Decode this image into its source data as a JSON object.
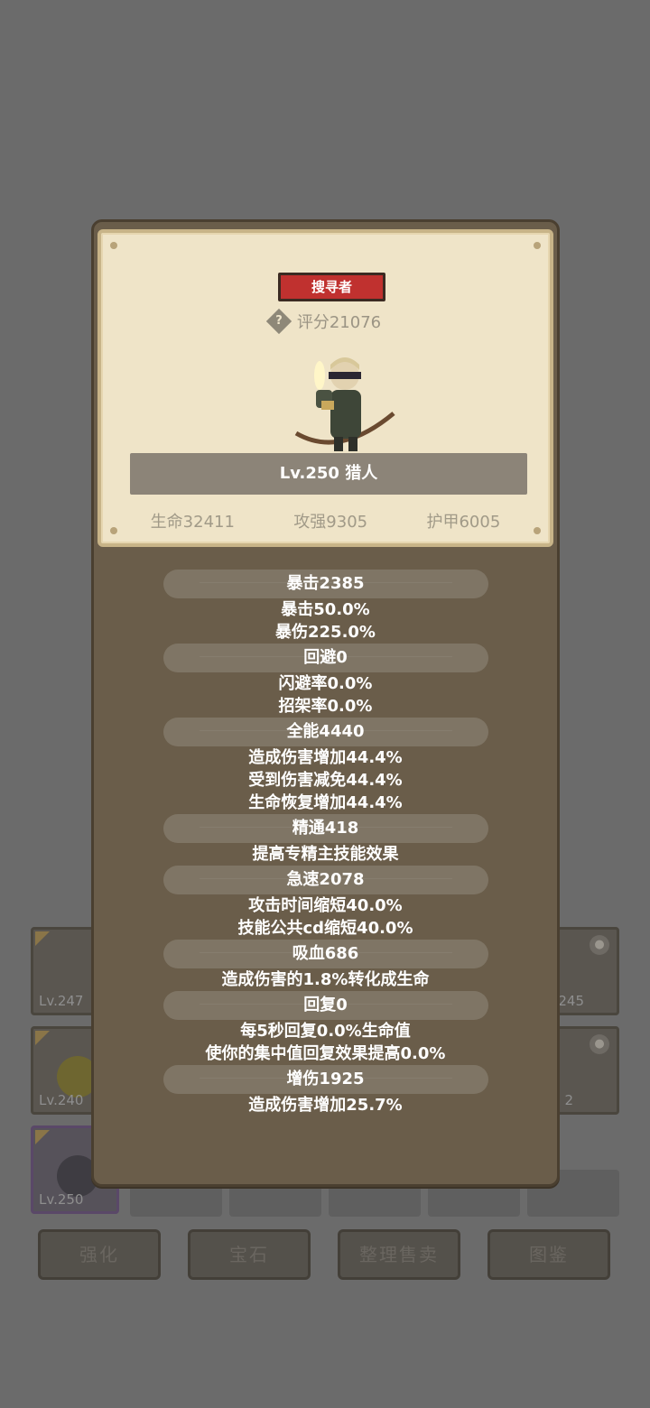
{
  "background": {
    "slot_levels": [
      "Lv.247",
      "Lv.240",
      "Lv.250"
    ],
    "right_slot_labels": [
      "245",
      "2"
    ],
    "buttons": [
      "强化",
      "宝石",
      "整理售卖",
      "图鉴"
    ]
  },
  "hero": {
    "class_badge": "搜寻者",
    "score": "评分21076",
    "nameplate": "Lv.250 猎人",
    "main_stats": [
      "生命32411",
      "攻强9305",
      "护甲6005"
    ]
  },
  "stats": [
    {
      "title": "暴击2385",
      "lines": [
        "暴击50.0%",
        "暴伤225.0%"
      ]
    },
    {
      "title": "回避0",
      "lines": [
        "闪避率0.0%",
        "招架率0.0%"
      ]
    },
    {
      "title": "全能4440",
      "lines": [
        "造成伤害增加44.4%",
        "受到伤害减免44.4%",
        "生命恢复增加44.4%"
      ]
    },
    {
      "title": "精通418",
      "lines": [
        "提高专精主技能效果"
      ]
    },
    {
      "title": "急速2078",
      "lines": [
        "攻击时间缩短40.0%",
        "技能公共cd缩短40.0%"
      ]
    },
    {
      "title": "吸血686",
      "lines": [
        "造成伤害的1.8%转化成生命"
      ]
    },
    {
      "title": "回复0",
      "lines": [
        "每5秒回复0.0%生命值",
        "使你的集中值回复效果提高0.0%"
      ]
    },
    {
      "title": "增伤1925",
      "lines": [
        "造成伤害增加25.7%"
      ]
    }
  ],
  "colors": {
    "badge_red": "#c0312f",
    "parchment": "#efe4c8",
    "panel_brown": "#6a5d4a"
  }
}
